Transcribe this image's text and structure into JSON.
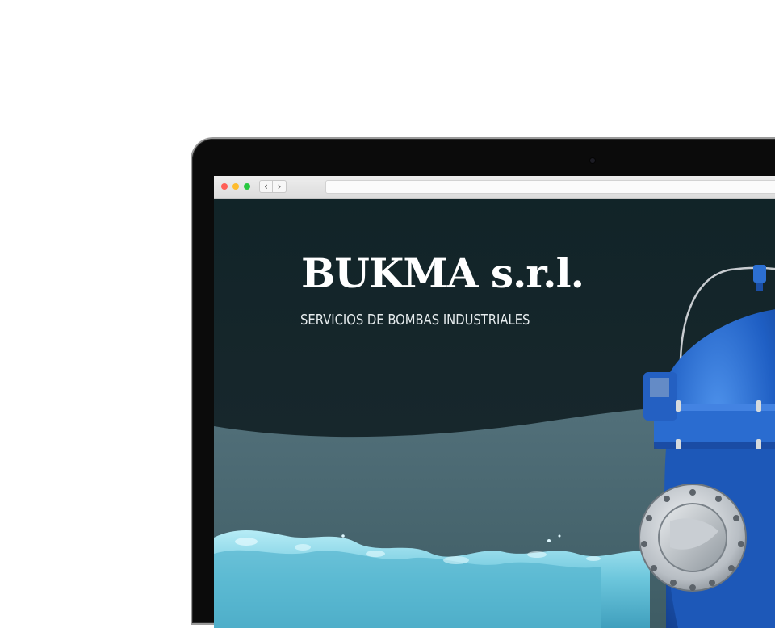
{
  "browser": {
    "back_glyph": "‹",
    "forward_glyph": "›"
  },
  "hero": {
    "title": "BUKMA s.r.l.",
    "subtitle": "SERVICIOS DE BOMBAS INDUSTRIALES"
  },
  "colors": {
    "hero_dark": "#112428",
    "wave_teal": "#4f6c74",
    "water": "#7fd2e6",
    "pump_blue": "#1f5fc4",
    "traffic_red": "#ff5f57",
    "traffic_yellow": "#febc2e",
    "traffic_green": "#28c840"
  }
}
